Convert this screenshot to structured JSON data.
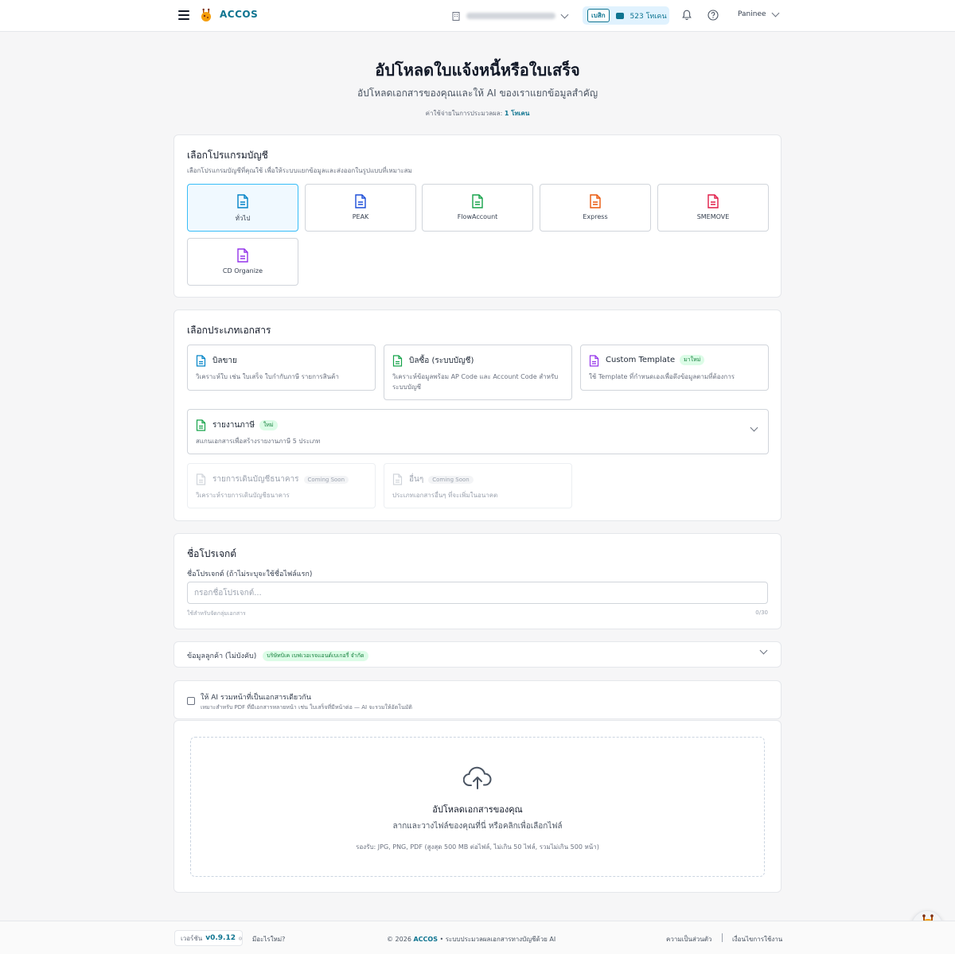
{
  "header": {
    "brand": "ACCOS",
    "plan_badge": "เบสิก",
    "token_balance": "523 โทเคน",
    "user_name": "Paninee"
  },
  "hero": {
    "title": "อัปโหลดใบแจ้งหนี้หรือใบเสร็จ",
    "subtitle": "อัปโหลดเอกสารของคุณและให้ AI ของเราแยกข้อมูลสำคัญ",
    "cost_label": "ค่าใช้จ่ายในการประมวลผล:",
    "cost_value": "1 โทเคน"
  },
  "program_section": {
    "title": "เลือกโปรแกรมบัญชี",
    "subtitle": "เลือกโปรแกรมบัญชีที่คุณใช้ เพื่อให้ระบบแยกข้อมูลและส่งออกในรูปแบบที่เหมาะสม",
    "programs": [
      {
        "label": "ทั่วไป",
        "color": "#0284c7",
        "selected": true
      },
      {
        "label": "PEAK",
        "color": "#1d4ed8",
        "selected": false
      },
      {
        "label": "FlowAccount",
        "color": "#16a34a",
        "selected": false
      },
      {
        "label": "Express",
        "color": "#ea580c",
        "selected": false
      },
      {
        "label": "SMEMOVE",
        "color": "#e11d48",
        "selected": false
      },
      {
        "label": "CD Organize",
        "color": "#9333ea",
        "selected": false
      }
    ]
  },
  "doc_type_section": {
    "title": "เลือกประเภทเอกสาร",
    "types": [
      {
        "title": "บิลขาย",
        "desc": "วิเคราะห์ใบ เช่น ใบเสร็จ ใบกำกับภาษี รายการสินค้า",
        "color": "#0284c7"
      },
      {
        "title": "บิลซื้อ (ระบบบัญชี)",
        "desc": "วิเคราะห์ข้อมูลพร้อม AP Code และ Account Code สำหรับระบบบัญชี",
        "color": "#16a34a"
      },
      {
        "title": "Custom Template",
        "tag": "มาใหม่",
        "desc": "ใช้ Template ที่กำหนดเองเพื่อดึงข้อมูลตามที่ต้องการ",
        "color": "#9333ea"
      },
      {
        "title": "รายงานภาษี",
        "tag": "ใหม่",
        "desc": "สแกนเอกสารเพื่อสร้างรายงานภาษี 5 ประเภท",
        "color": "#16a34a"
      },
      {
        "title": "รายการเดินบัญชีธนาคาร",
        "tag": "Coming Soon",
        "desc": "วิเคราะห์รายการเดินบัญชีธนาคาร",
        "color": "#9ca3af"
      },
      {
        "title": "อื่นๆ",
        "tag": "Coming Soon",
        "desc": "ประเภทเอกสารอื่นๆ ที่จะเพิ่มในอนาคต",
        "color": "#9ca3af"
      }
    ]
  },
  "project_section": {
    "title": "ชื่อโปรเจกต์",
    "field_label": "ชื่อโปรเจกต์ (ถ้าไม่ระบุจะใช้ชื่อไฟล์แรก)",
    "placeholder": "กรอกชื่อโปรเจกต์...",
    "helper": "ใช้สำหรับจัดกลุ่มเอกสาร",
    "counter": "0/30"
  },
  "customer_section": {
    "label": "ข้อมูลลูกค้า (ไม่บังคับ)",
    "customer": "บริษัทบิเค เบฟเวอเรจแอนด์เบเกอรี่ จำกัด"
  },
  "merge_section": {
    "label": "ให้ AI รวมหน้าที่เป็นเอกสารเดียวกัน",
    "desc": "เหมาะสำหรับ PDF ที่มีเอกสารหลายหน้า เช่น ใบเสร็จที่มีหน้าต่อ — AI จะรวมให้อัตโนมัติ"
  },
  "upload": {
    "title": "อัปโหลดเอกสารของคุณ",
    "subtitle": "ลากและวางไฟล์ของคุณที่นี่ หรือคลิกเพื่อเลือกไฟล์",
    "formats": "รองรับ: JPG, PNG, PDF (สูงสุด 500 MB ต่อไฟล์, ไม่เกิน 50 ไฟล์, รวมไม่เกิน 500 หน้า)"
  },
  "footer": {
    "version_label": "เวอร์ชัน",
    "version": "v0.9.12",
    "whats_new": "มีอะไรใหม่?",
    "copyright_prefix": "© 2026",
    "copyright_brand": "ACCOS",
    "copyright_suffix": "• ระบบประมวลผลเอกสารทางบัญชีด้วย AI",
    "privacy": "ความเป็นส่วนตัว",
    "terms": "เงื่อนไขการใช้งาน"
  }
}
